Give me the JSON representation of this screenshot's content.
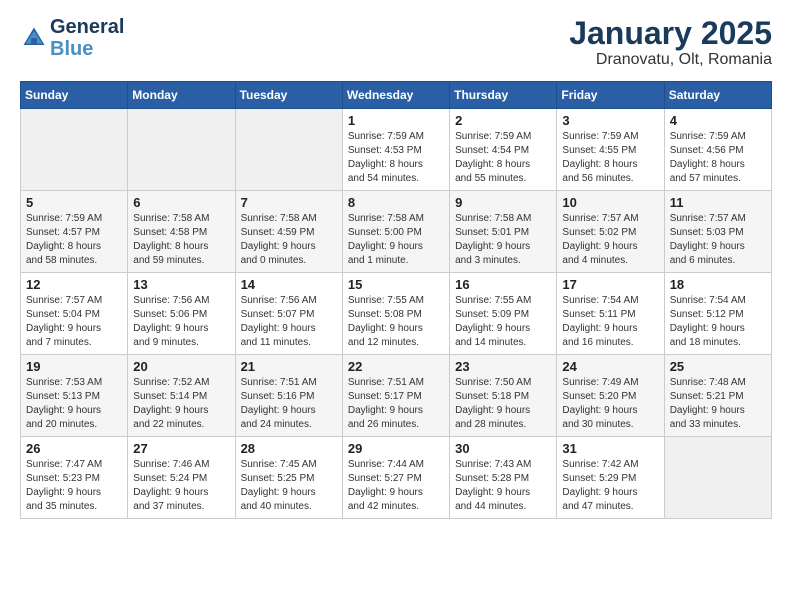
{
  "header": {
    "logo_general": "General",
    "logo_blue": "Blue",
    "title": "January 2025",
    "subtitle": "Dranovatu, Olt, Romania"
  },
  "calendar": {
    "days_of_week": [
      "Sunday",
      "Monday",
      "Tuesday",
      "Wednesday",
      "Thursday",
      "Friday",
      "Saturday"
    ],
    "weeks": [
      [
        {
          "day": "",
          "info": ""
        },
        {
          "day": "",
          "info": ""
        },
        {
          "day": "",
          "info": ""
        },
        {
          "day": "1",
          "info": "Sunrise: 7:59 AM\nSunset: 4:53 PM\nDaylight: 8 hours\nand 54 minutes."
        },
        {
          "day": "2",
          "info": "Sunrise: 7:59 AM\nSunset: 4:54 PM\nDaylight: 8 hours\nand 55 minutes."
        },
        {
          "day": "3",
          "info": "Sunrise: 7:59 AM\nSunset: 4:55 PM\nDaylight: 8 hours\nand 56 minutes."
        },
        {
          "day": "4",
          "info": "Sunrise: 7:59 AM\nSunset: 4:56 PM\nDaylight: 8 hours\nand 57 minutes."
        }
      ],
      [
        {
          "day": "5",
          "info": "Sunrise: 7:59 AM\nSunset: 4:57 PM\nDaylight: 8 hours\nand 58 minutes."
        },
        {
          "day": "6",
          "info": "Sunrise: 7:58 AM\nSunset: 4:58 PM\nDaylight: 8 hours\nand 59 minutes."
        },
        {
          "day": "7",
          "info": "Sunrise: 7:58 AM\nSunset: 4:59 PM\nDaylight: 9 hours\nand 0 minutes."
        },
        {
          "day": "8",
          "info": "Sunrise: 7:58 AM\nSunset: 5:00 PM\nDaylight: 9 hours\nand 1 minute."
        },
        {
          "day": "9",
          "info": "Sunrise: 7:58 AM\nSunset: 5:01 PM\nDaylight: 9 hours\nand 3 minutes."
        },
        {
          "day": "10",
          "info": "Sunrise: 7:57 AM\nSunset: 5:02 PM\nDaylight: 9 hours\nand 4 minutes."
        },
        {
          "day": "11",
          "info": "Sunrise: 7:57 AM\nSunset: 5:03 PM\nDaylight: 9 hours\nand 6 minutes."
        }
      ],
      [
        {
          "day": "12",
          "info": "Sunrise: 7:57 AM\nSunset: 5:04 PM\nDaylight: 9 hours\nand 7 minutes."
        },
        {
          "day": "13",
          "info": "Sunrise: 7:56 AM\nSunset: 5:06 PM\nDaylight: 9 hours\nand 9 minutes."
        },
        {
          "day": "14",
          "info": "Sunrise: 7:56 AM\nSunset: 5:07 PM\nDaylight: 9 hours\nand 11 minutes."
        },
        {
          "day": "15",
          "info": "Sunrise: 7:55 AM\nSunset: 5:08 PM\nDaylight: 9 hours\nand 12 minutes."
        },
        {
          "day": "16",
          "info": "Sunrise: 7:55 AM\nSunset: 5:09 PM\nDaylight: 9 hours\nand 14 minutes."
        },
        {
          "day": "17",
          "info": "Sunrise: 7:54 AM\nSunset: 5:11 PM\nDaylight: 9 hours\nand 16 minutes."
        },
        {
          "day": "18",
          "info": "Sunrise: 7:54 AM\nSunset: 5:12 PM\nDaylight: 9 hours\nand 18 minutes."
        }
      ],
      [
        {
          "day": "19",
          "info": "Sunrise: 7:53 AM\nSunset: 5:13 PM\nDaylight: 9 hours\nand 20 minutes."
        },
        {
          "day": "20",
          "info": "Sunrise: 7:52 AM\nSunset: 5:14 PM\nDaylight: 9 hours\nand 22 minutes."
        },
        {
          "day": "21",
          "info": "Sunrise: 7:51 AM\nSunset: 5:16 PM\nDaylight: 9 hours\nand 24 minutes."
        },
        {
          "day": "22",
          "info": "Sunrise: 7:51 AM\nSunset: 5:17 PM\nDaylight: 9 hours\nand 26 minutes."
        },
        {
          "day": "23",
          "info": "Sunrise: 7:50 AM\nSunset: 5:18 PM\nDaylight: 9 hours\nand 28 minutes."
        },
        {
          "day": "24",
          "info": "Sunrise: 7:49 AM\nSunset: 5:20 PM\nDaylight: 9 hours\nand 30 minutes."
        },
        {
          "day": "25",
          "info": "Sunrise: 7:48 AM\nSunset: 5:21 PM\nDaylight: 9 hours\nand 33 minutes."
        }
      ],
      [
        {
          "day": "26",
          "info": "Sunrise: 7:47 AM\nSunset: 5:23 PM\nDaylight: 9 hours\nand 35 minutes."
        },
        {
          "day": "27",
          "info": "Sunrise: 7:46 AM\nSunset: 5:24 PM\nDaylight: 9 hours\nand 37 minutes."
        },
        {
          "day": "28",
          "info": "Sunrise: 7:45 AM\nSunset: 5:25 PM\nDaylight: 9 hours\nand 40 minutes."
        },
        {
          "day": "29",
          "info": "Sunrise: 7:44 AM\nSunset: 5:27 PM\nDaylight: 9 hours\nand 42 minutes."
        },
        {
          "day": "30",
          "info": "Sunrise: 7:43 AM\nSunset: 5:28 PM\nDaylight: 9 hours\nand 44 minutes."
        },
        {
          "day": "31",
          "info": "Sunrise: 7:42 AM\nSunset: 5:29 PM\nDaylight: 9 hours\nand 47 minutes."
        },
        {
          "day": "",
          "info": ""
        }
      ]
    ]
  }
}
